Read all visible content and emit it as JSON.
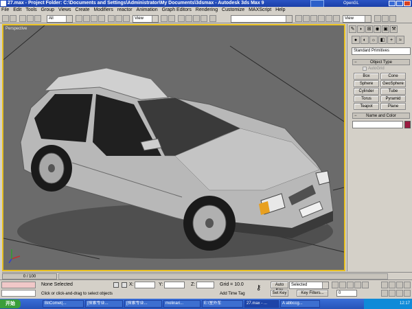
{
  "window": {
    "title": "27.max - Project Folder: C:\\Documents and Settings\\Administrator\\My Documents\\3dsmax - Autodesk 3ds Max 9"
  },
  "logo_text": "OpenGL",
  "menu": [
    "File",
    "Edit",
    "Tools",
    "Group",
    "Views",
    "Create",
    "Modifiers",
    "reactor",
    "Animation",
    "Graph Editors",
    "Rendering",
    "Customize",
    "MAXScript",
    "Help"
  ],
  "toolbar": {
    "selection_filter": "All",
    "reference_coord": "View",
    "named_selection": "",
    "view_dropdown": "View"
  },
  "viewport": {
    "label": "Perspective"
  },
  "command_panel": {
    "category_dropdown": "Standard Primitives",
    "object_type_title": "Object Type",
    "autogrid_label": "AutoGrid",
    "buttons": [
      "Box",
      "Cone",
      "Sphere",
      "GeoSphere",
      "Cylinder",
      "Tube",
      "Torus",
      "Pyramid",
      "Teapot",
      "Plane"
    ],
    "name_color_title": "Name and Color",
    "object_name": "",
    "object_color": "#9b1b40"
  },
  "timeline": {
    "frame_readout": "0 / 100"
  },
  "status": {
    "selection_text": "None Selected",
    "prompt_text": "Click or click-and-drag to select objects",
    "x_label": "X:",
    "y_label": "Y:",
    "z_label": "Z:",
    "x_value": "",
    "y_value": "",
    "z_value": "",
    "grid_text": "Grid = 10.0",
    "add_time_tag": "Add Time Tag",
    "auto_key": "Auto Key",
    "set_key": "Set Key",
    "key_mode": "Selected",
    "key_filters": "Key Filters...",
    "frame_value": "0"
  },
  "taskbar": {
    "start_label": "开始",
    "tasks": [
      "BitComet(...",
      "[探索专业...",
      "[探索专业...",
      "molinari...",
      "E:\\室外车",
      "27.max - ...",
      "A  abbccg..."
    ],
    "clock": "12:17"
  }
}
